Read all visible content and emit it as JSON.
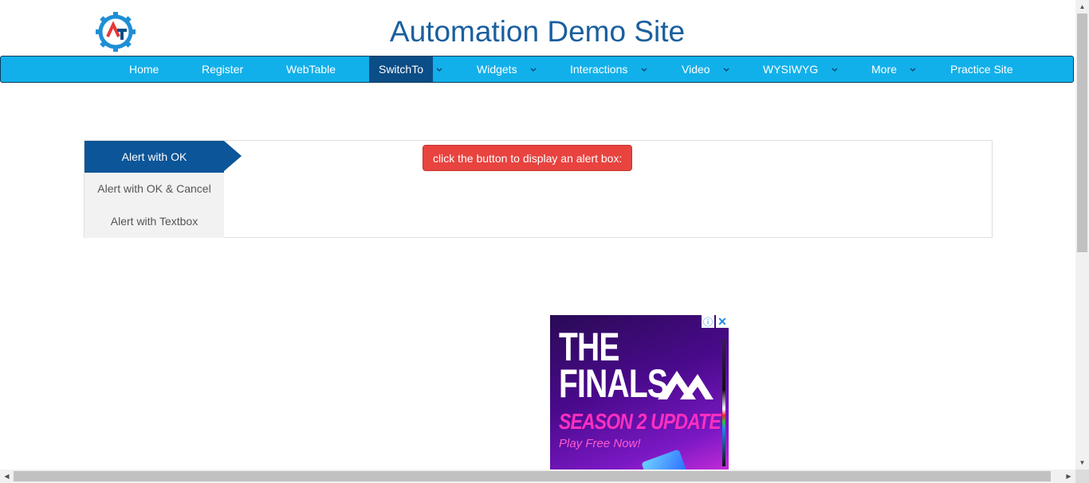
{
  "header": {
    "title": "Automation Demo Site",
    "logo_icon": "gear-logo-icon"
  },
  "nav": {
    "items": [
      {
        "label": "Home",
        "has_dropdown": false
      },
      {
        "label": "Register",
        "has_dropdown": false
      },
      {
        "label": "WebTable",
        "has_dropdown": false
      },
      {
        "label": "SwitchTo",
        "has_dropdown": true,
        "active": true
      },
      {
        "label": "Widgets",
        "has_dropdown": true
      },
      {
        "label": "Interactions",
        "has_dropdown": true
      },
      {
        "label": "Video",
        "has_dropdown": true
      },
      {
        "label": "WYSIWYG",
        "has_dropdown": true
      },
      {
        "label": "More",
        "has_dropdown": true
      },
      {
        "label": "Practice Site",
        "has_dropdown": false
      }
    ]
  },
  "tabs": {
    "items": [
      {
        "label": "Alert with OK",
        "active": true
      },
      {
        "label": "Alert with OK & Cancel"
      },
      {
        "label": "Alert with Textbox"
      }
    ],
    "content_button": "click the button to display an alert box:"
  },
  "ad": {
    "line1": "THE",
    "line2": "FINALS",
    "line3": "SEASON 2 UPDATE",
    "line4": "Play Free Now!",
    "info_icon": "ⓘ",
    "close_icon": "✕"
  },
  "colors": {
    "nav_bg": "#12b0ea",
    "nav_active": "#0b4d87",
    "title": "#1a5f9e",
    "tab_active": "#0b5598",
    "alert_button": "#e8433f"
  }
}
